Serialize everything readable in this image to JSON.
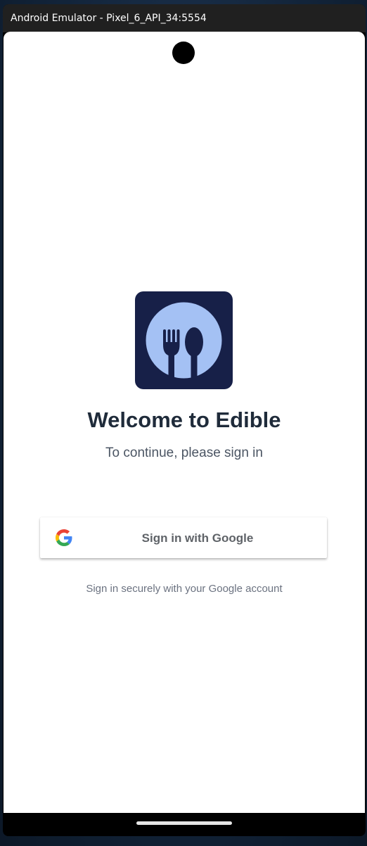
{
  "window": {
    "title": "Android Emulator - Pixel_6_API_34:5554"
  },
  "app": {
    "logo_icon": "fork-and-spoon-icon",
    "colors": {
      "logo_background": "#172048",
      "logo_circle": "#a4c1f4",
      "title_text": "#1f2b3a"
    }
  },
  "welcome": {
    "title": "Welcome to Edible",
    "subtitle": "To continue, please sign in"
  },
  "google_signin": {
    "icon": "google-g-icon",
    "label": "Sign in with Google",
    "note": "Sign in securely with your Google account"
  }
}
